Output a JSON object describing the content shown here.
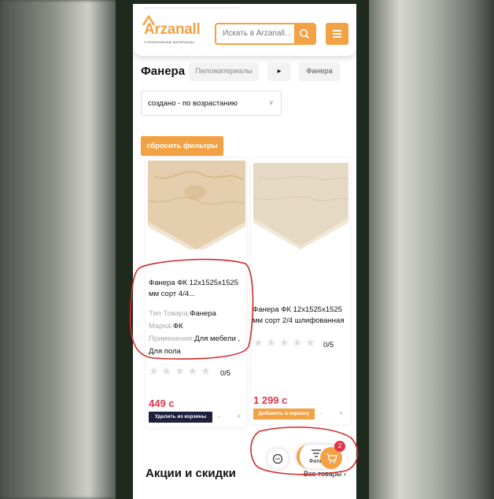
{
  "header": {
    "logo_text": "Arzanall",
    "logo_subtitle": "СТРОИТЕЛЬНЫЕ МАТЕРИАЛЫ",
    "search_placeholder": "Искать в Arzanall..."
  },
  "breadcrumb": {
    "title": "Фанера",
    "items": [
      "Пиломатериалы",
      "▸",
      "Фанера"
    ]
  },
  "sort": {
    "selected": "создано - по возрастанию"
  },
  "filters": {
    "reset_label": "сбросить фильтры"
  },
  "products": [
    {
      "name": "Фанера ФК 12х1525х1525 мм сорт 4/4...",
      "attributes": [
        {
          "label": "Тип Товара",
          "value": "Фанера"
        },
        {
          "label": "Марка",
          "value": "ФК"
        },
        {
          "label": "Применение",
          "value": "Для мебели , Для пола"
        }
      ],
      "rating": 0,
      "rating_text": "0/5",
      "price": "449 с",
      "cart_button": "Удалить из корзины",
      "qty_minus": "-",
      "qty_plus": "+"
    },
    {
      "name": "Фанера ФК 12х1525х1525 мм сорт 2/4 шлифованная",
      "attributes": [],
      "rating": 0,
      "rating_text": "0/5",
      "price": "1 299 с",
      "cart_button": "Добавить в корзину",
      "qty_minus": "-",
      "qty_plus": "+"
    }
  ],
  "promo": {
    "title": "Акции и скидки",
    "all_link": "Все товары"
  },
  "floating": {
    "filter_label": "Фильтр",
    "cart_count": "2"
  },
  "colors": {
    "accent": "#f2a244",
    "price": "#e0354a",
    "dark_button": "#1d1f3d",
    "annotation": "#d02a2a"
  }
}
